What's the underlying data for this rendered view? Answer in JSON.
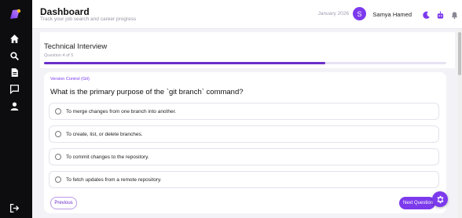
{
  "header": {
    "title": "Dashboard",
    "subtitle": "Track your job search and career progress",
    "date": "January 2026",
    "user_initial": "S",
    "user_name": "Samya Hamed"
  },
  "sidebar": {
    "items": [
      {
        "icon": "home-icon"
      },
      {
        "icon": "search-icon"
      },
      {
        "icon": "document-icon"
      },
      {
        "icon": "chat-icon"
      },
      {
        "icon": "user-icon"
      }
    ],
    "logout_icon": "logout-icon"
  },
  "interview": {
    "title": "Technical Interview",
    "progress_text": "Question 4 of 5",
    "progress_fraction": 0.7
  },
  "question": {
    "category": "Version Control (Git)",
    "text": "What is the primary purpose of the `git branch` command?",
    "options": [
      "To merge changes from one branch into another.",
      "To create, list, or delete branches.",
      "To commit changes to the repository.",
      "To fetch updates from a remote repository."
    ]
  },
  "actions": {
    "previous": "Previous",
    "next": "Next Question"
  },
  "colors": {
    "accent": "#7c3aed",
    "sidebar": "#0d0d0f"
  }
}
